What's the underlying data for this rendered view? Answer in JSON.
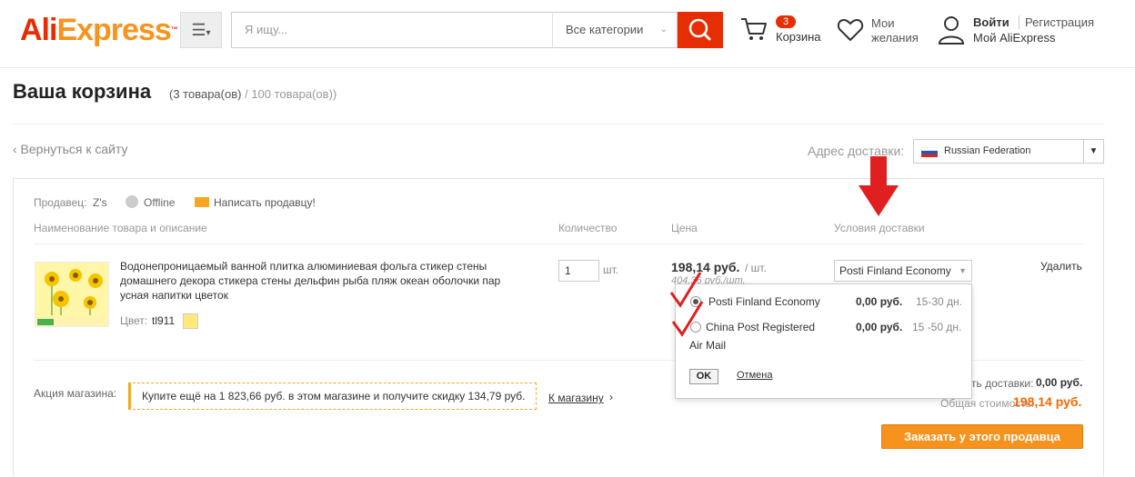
{
  "header": {
    "logo_ali": "Ali",
    "logo_express": "Express",
    "logo_tm": "™",
    "search_placeholder": "Я ищу...",
    "category": "Все категории",
    "cart_count": "3",
    "cart_label": "Корзина",
    "wishlist_line1": "Мои",
    "wishlist_line2": "желания",
    "login": "Войти",
    "register": "Регистрация",
    "my_aliexpress": "Мой AliExpress"
  },
  "page": {
    "title": "Ваша корзина",
    "count_current": "(3 товара(ов)",
    "count_max": "/ 100 товара(ов))",
    "back_link": "‹ Вернуться к сайту",
    "ship_to_label": "Адрес доставки:",
    "ship_to_country": "Russian Federation"
  },
  "seller": {
    "label": "Продавец:",
    "name": "Z's",
    "status": "Offline",
    "contact": "Написать продавцу!",
    "col_product": "Наименование товара и описание",
    "col_qty": "Количество",
    "col_price": "Цена",
    "col_shipping": "Условия доставки"
  },
  "item": {
    "description": "Водонепроницаемый ванной плитка алюминиевая фольга стикер стены домашнего декора стикера стены дельфин рыба пляж океан оболочки пар усная напитки цветок",
    "color_label": "Цвет:",
    "color_value": "tl911",
    "qty": "1",
    "qty_unit": "шт.",
    "price": "198,14 руб.",
    "price_unit": "/ шт.",
    "price_old": "404,36 руб./шт.",
    "shipping_method": "Posti Finland Economy",
    "delete": "Удалить"
  },
  "promo": {
    "label": "Акция магазина:",
    "text": "Купите ещё на 1 823,66 руб. в этом магазине и получите скидку 134,79 руб.",
    "store_link": "К магазину",
    "store_arrow": "›"
  },
  "totals": {
    "shipping_label": "ть доставки:",
    "shipping_value": "0,00 руб.",
    "total_label": "Общая стоимость:",
    "total_value": "198,14 руб.",
    "order_button": "Заказать у этого продавца"
  },
  "shipping_popup": {
    "options": [
      {
        "name": "Posti Finland Economy",
        "price": "0,00 руб.",
        "days": "15-30 дн.",
        "selected": true
      },
      {
        "name": "China Post Registered",
        "name_line2": "Air Mail",
        "price": "0,00 руб.",
        "days": "15 -50 дн.",
        "selected": false
      }
    ],
    "ok": "OK",
    "cancel": "Отмена"
  },
  "colors": {
    "brand_red": "#e62e04",
    "brand_orange": "#f7941d",
    "order_button": "#f6921e",
    "total_price": "#f56a00",
    "annotation": "#e02020"
  }
}
